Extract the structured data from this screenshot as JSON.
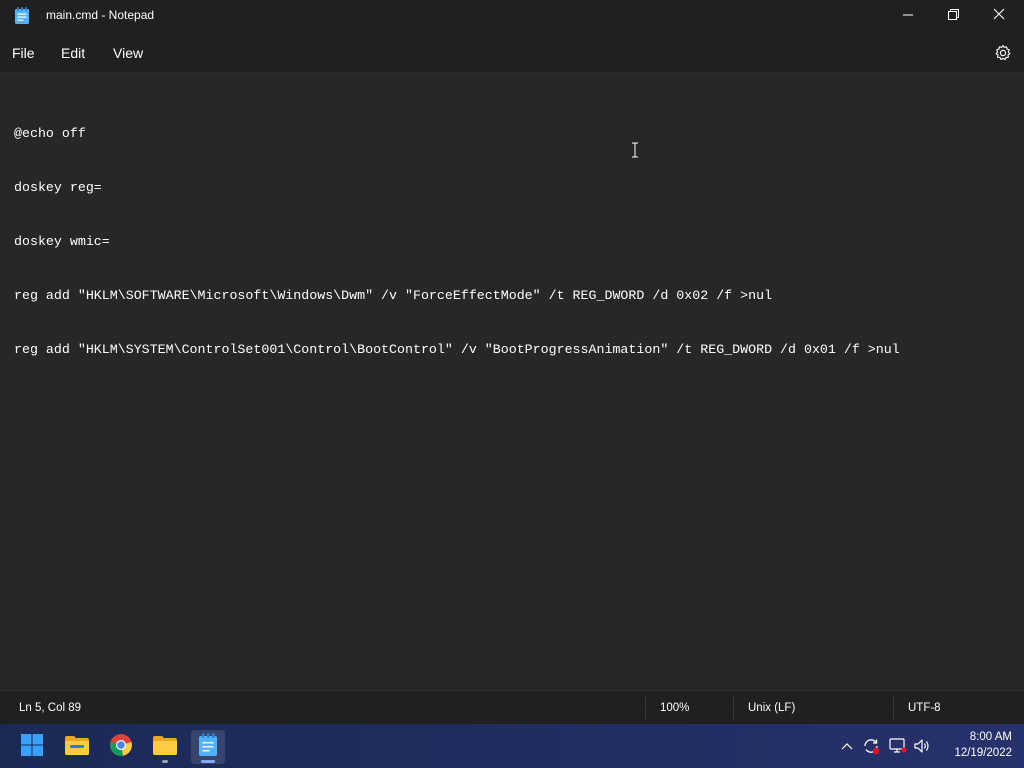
{
  "window": {
    "title": "main.cmd - Notepad"
  },
  "menu": {
    "file": "File",
    "edit": "Edit",
    "view": "View"
  },
  "editor": {
    "lines": [
      "@echo off",
      "doskey reg=",
      "doskey wmic=",
      "reg add \"HKLM\\SOFTWARE\\Microsoft\\Windows\\Dwm\" /v \"ForceEffectMode\" /t REG_DWORD /d 0x02 /f >nul",
      "reg add \"HKLM\\SYSTEM\\ControlSet001\\Control\\BootControl\" /v \"BootProgressAnimation\" /t REG_DWORD /d 0x01 /f >nul"
    ]
  },
  "status": {
    "position": "Ln 5, Col 89",
    "zoom": "100%",
    "line_ending": "Unix (LF)",
    "encoding": "UTF-8"
  },
  "taskbar": {
    "pinned": [
      "start-icon",
      "file-explorer-icon",
      "chrome-icon",
      "folder-icon",
      "notepad-icon"
    ],
    "clock_time": "8:00 AM",
    "clock_date": "12/19/2022"
  },
  "colors": {
    "editor_bg": "#272727",
    "chrome_bg": "#202020",
    "accent": "#8aa8ff"
  }
}
